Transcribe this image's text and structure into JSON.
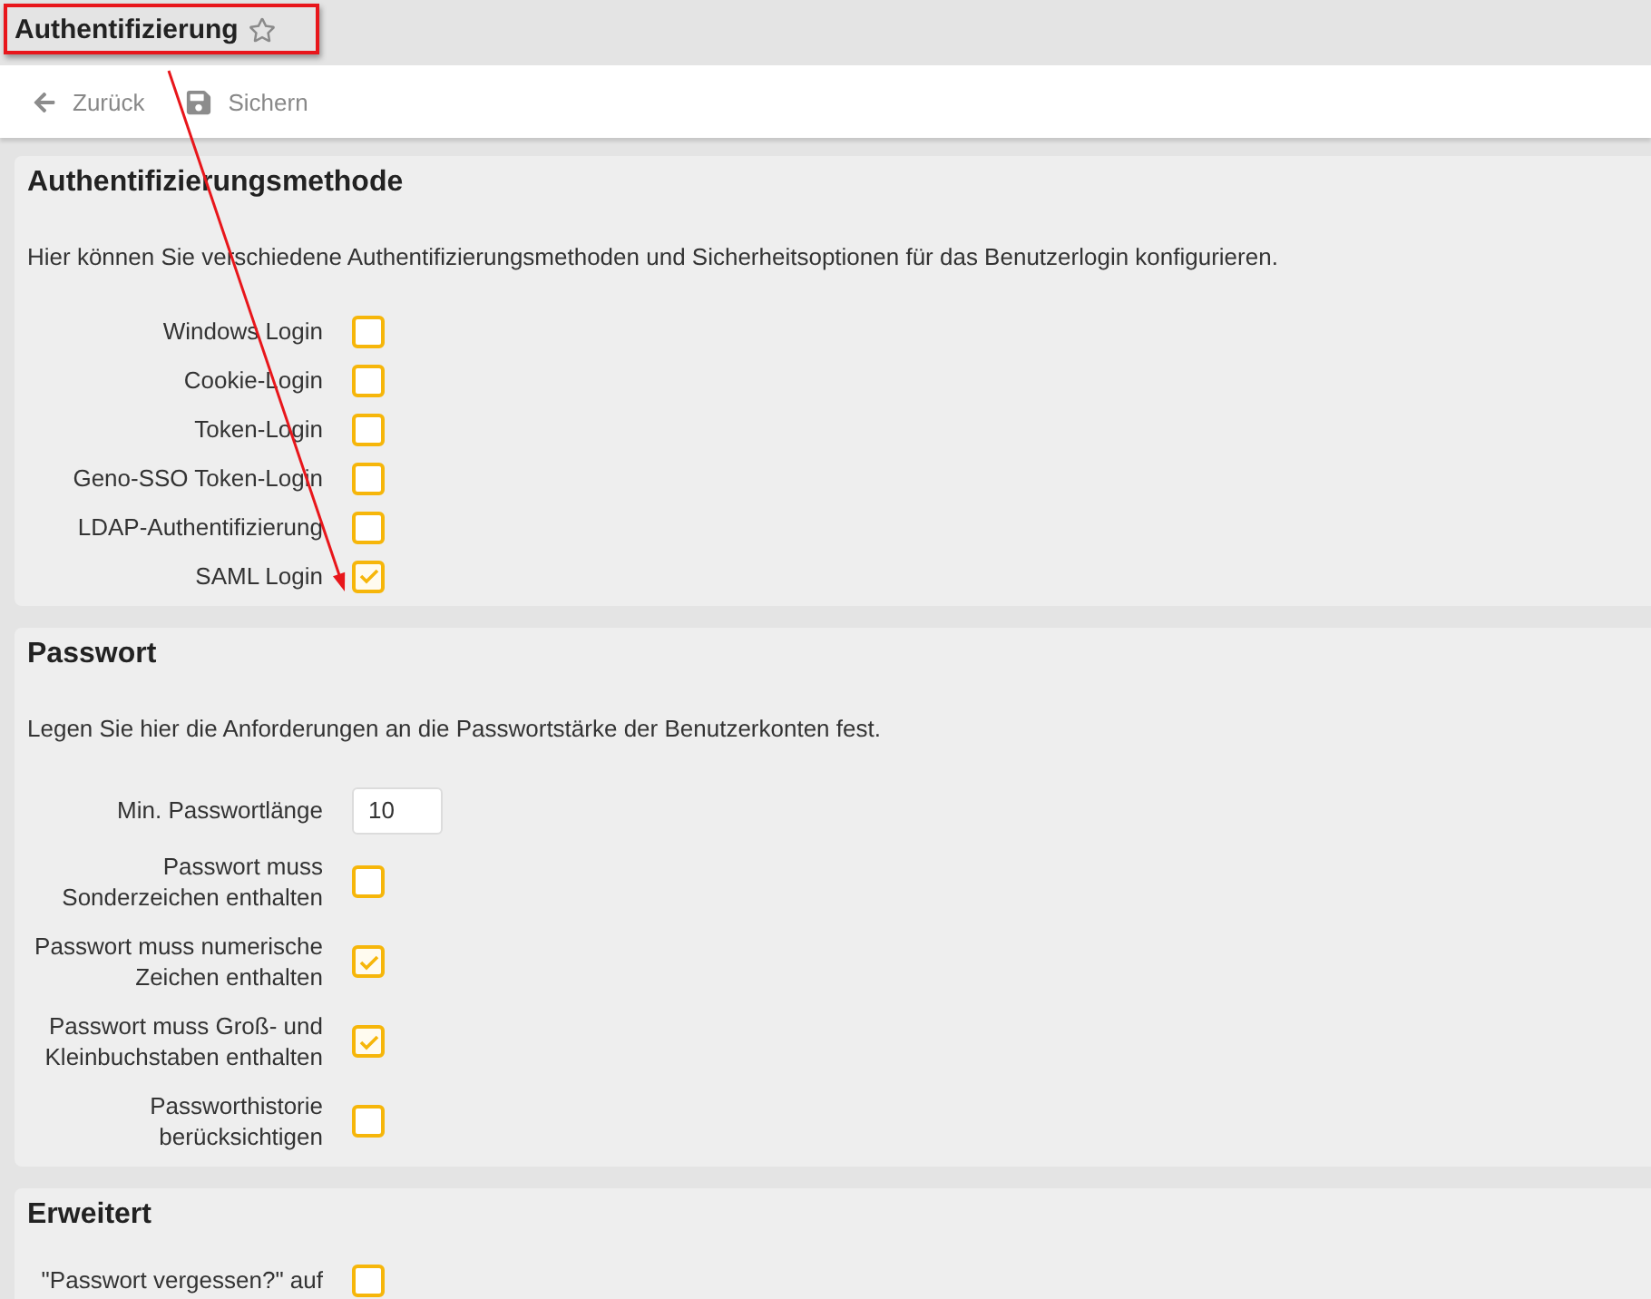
{
  "header": {
    "title": "Authentifizierung",
    "favorite": false
  },
  "toolbar": [
    {
      "kind": "back",
      "label": "Zurück"
    },
    {
      "kind": "save",
      "label": "Sichern"
    }
  ],
  "sections": [
    {
      "title": "Authentifizierungsmethode",
      "description": "Hier können Sie verschiedene Authentifizierungsmethoden und Sicherheitsoptionen für das Benutzerlogin konfigurieren.",
      "fields": [
        {
          "kind": "checkbox",
          "label": "Windows Login",
          "checked": false
        },
        {
          "kind": "checkbox",
          "label": "Cookie-Login",
          "checked": false
        },
        {
          "kind": "checkbox",
          "label": "Token-Login",
          "checked": false
        },
        {
          "kind": "checkbox",
          "label": "Geno-SSO Token-Login",
          "checked": false
        },
        {
          "kind": "checkbox",
          "label": "LDAP-Authentifizierung",
          "checked": false
        },
        {
          "kind": "checkbox",
          "label": "SAML Login",
          "checked": true
        }
      ]
    },
    {
      "title": "Passwort",
      "description": "Legen Sie hier die Anforderungen an die Passwortstärke der Benutzerkonten fest.",
      "fields": [
        {
          "kind": "number",
          "label": "Min. Passwortlänge",
          "value": "10"
        },
        {
          "kind": "checkbox",
          "label": "Passwort muss Sonderzeichen enthalten",
          "checked": false
        },
        {
          "kind": "checkbox",
          "label": "Passwort muss numerische Zeichen enthalten",
          "checked": true
        },
        {
          "kind": "checkbox",
          "label": "Passwort muss Groß- und Kleinbuchstaben enthalten",
          "checked": true
        },
        {
          "kind": "checkbox",
          "label": "Passworthistorie berücksichtigen",
          "checked": false
        }
      ]
    },
    {
      "title": "Erweitert",
      "fields": [
        {
          "kind": "checkbox",
          "label": "\"Passwort vergessen?\" auf",
          "checked": false
        }
      ]
    }
  ]
}
